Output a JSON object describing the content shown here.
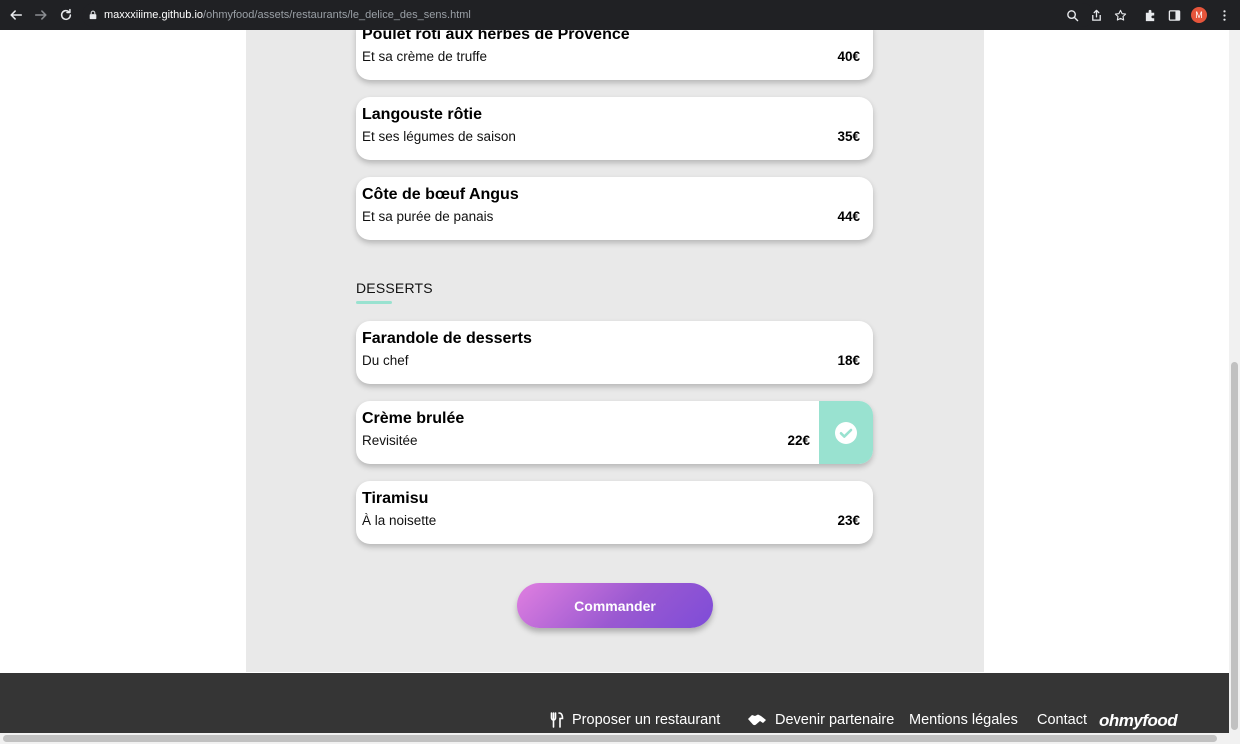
{
  "browser": {
    "url_host": "maxxxiiime.github.io",
    "url_path": "/ohmyfood/assets/restaurants/le_delice_des_sens.html",
    "avatar_letter": "M"
  },
  "menu": {
    "main_dishes": [
      {
        "name": "Poulet rôti aux herbes de Provence",
        "description": "Et sa crème de truffe",
        "price": "40€"
      },
      {
        "name": "Langouste rôtie",
        "description": "Et ses légumes de saison",
        "price": "35€"
      },
      {
        "name": "Côte de bœuf Angus",
        "description": "Et sa purée de panais",
        "price": "44€"
      }
    ],
    "desserts_title": "DESSERTS",
    "desserts": [
      {
        "name": "Farandole de desserts",
        "description": "Du chef",
        "price": "18€"
      },
      {
        "name": "Crème brulée",
        "description": "Revisitée",
        "price": "22€",
        "selected": true
      },
      {
        "name": "Tiramisu",
        "description": "À la noisette",
        "price": "23€"
      }
    ],
    "order_label": "Commander"
  },
  "footer": {
    "propose_label": "Proposer un restaurant",
    "partner_label": "Devenir partenaire",
    "legal_label": "Mentions légales",
    "contact_label": "Contact",
    "logo_text": "ohmyfood"
  },
  "colors": {
    "accent_mint": "#99e2d0",
    "button_gradient_start": "#e07fe0",
    "button_gradient_end": "#7e4cd8",
    "footer_bg": "#353535",
    "panel_bg": "#e9e9e9"
  }
}
